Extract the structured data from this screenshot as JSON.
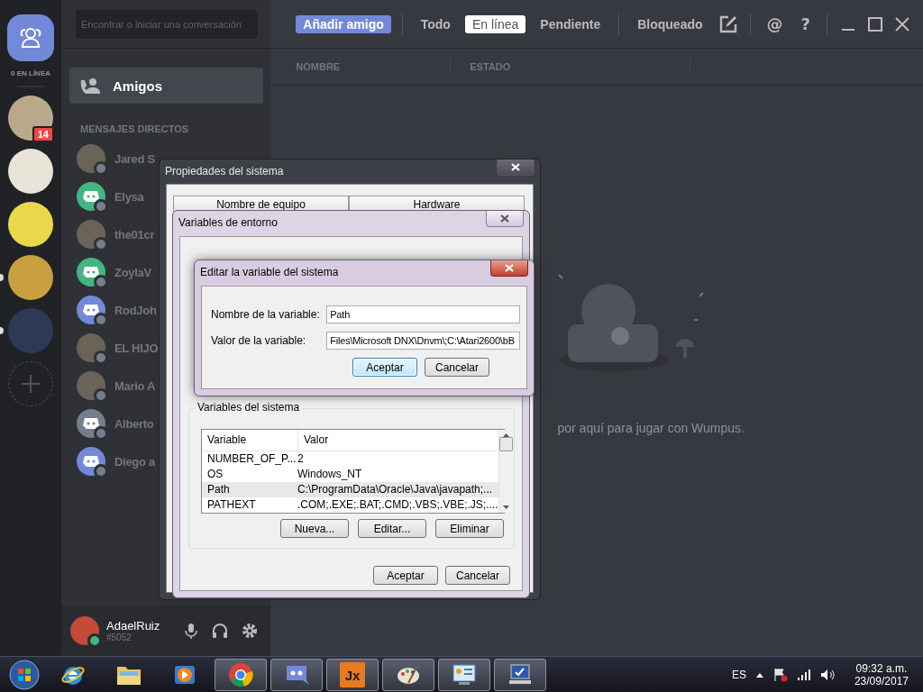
{
  "guild_rail": {
    "online_label": "0 EN LÍNEA",
    "servers": [
      {
        "badge": "14",
        "unread": false
      },
      {
        "unread": false
      },
      {
        "unread": false
      },
      {
        "unread": true
      },
      {
        "unread": true
      }
    ]
  },
  "search": {
    "placeholder": "Encontrar o iniciar una conversación"
  },
  "friends_item": {
    "label": "Amigos",
    "selected": true
  },
  "dm_section": "MENSAJES DIRECTOS",
  "dms": [
    {
      "name": "Jared S",
      "kind": "photo"
    },
    {
      "name": "Elysa",
      "kind": "default",
      "color": "#43b581"
    },
    {
      "name": "the01cr",
      "kind": "photo"
    },
    {
      "name": "ZoylaV",
      "kind": "default",
      "color": "#43b581"
    },
    {
      "name": "RodJoh",
      "kind": "default",
      "color": "#7289da"
    },
    {
      "name": "EL HIJO",
      "kind": "photo"
    },
    {
      "name": "Mario A",
      "kind": "photo"
    },
    {
      "name": "Alberto",
      "kind": "default",
      "color": "#747f8d"
    },
    {
      "name": "Diego a",
      "kind": "default",
      "color": "#7289da"
    }
  ],
  "user": {
    "name": "AdaelRuiz",
    "tag": "#5052"
  },
  "tabs": [
    {
      "label": "Añadir amigo",
      "kind": "button"
    },
    {
      "label": "Todo",
      "kind": "tab",
      "selected": false
    },
    {
      "label": "En línea",
      "kind": "tab",
      "selected": true
    },
    {
      "label": "Pendiente",
      "kind": "tab",
      "selected": false
    },
    {
      "label": "Bloqueado",
      "kind": "tab",
      "selected": false
    }
  ],
  "header_icons": [
    "@",
    "?"
  ],
  "columns": [
    "NOMBRE",
    "ESTADO"
  ],
  "empty_text": "por aquí para jugar con Wumpus.",
  "system_properties": {
    "title": "Propiedades del sistema",
    "tabs": [
      "Nombre de equipo",
      "Hardware"
    ]
  },
  "environment_variables": {
    "title": "Variables de entorno",
    "group_title": "Variables del sistema",
    "columns": [
      "Variable",
      "Valor"
    ],
    "rows": [
      {
        "variable": "NUMBER_OF_P...",
        "value": "2",
        "selected": false
      },
      {
        "variable": "OS",
        "value": "Windows_NT",
        "selected": false
      },
      {
        "variable": "Path",
        "value": "C:\\ProgramData\\Oracle\\Java\\javapath;...",
        "selected": true
      },
      {
        "variable": "PATHEXT",
        "value": ".COM;.EXE;.BAT;.CMD;.VBS;.VBE;.JS;....",
        "selected": false
      }
    ],
    "row_buttons": [
      "Nueva...",
      "Editar...",
      "Eliminar"
    ],
    "buttons": [
      "Aceptar",
      "Cancelar"
    ]
  },
  "edit_variable": {
    "title": "Editar la variable del sistema",
    "name_label": "Nombre de la variable:",
    "name_value": "Path",
    "value_label": "Valor de la variable:",
    "value": "Files\\Microsoft DNX\\Dnvm\\;C:\\Atari2600\\bB",
    "buttons": [
      {
        "label": "Aceptar",
        "default": true
      },
      {
        "label": "Cancelar",
        "default": false
      }
    ]
  },
  "taskbar": {
    "apps": [
      {
        "kind": "ie",
        "open": false
      },
      {
        "kind": "folder",
        "open": false
      },
      {
        "kind": "media",
        "open": false
      },
      {
        "kind": "chrome",
        "open": true
      },
      {
        "kind": "discord",
        "open": true
      },
      {
        "kind": "jx",
        "label": "Jx",
        "open": true
      },
      {
        "kind": "paint",
        "open": true
      },
      {
        "kind": "panel",
        "open": true
      },
      {
        "kind": "system",
        "open": true
      }
    ],
    "language": "ES",
    "time": "09:32 a.m.",
    "date": "23/09/2017"
  }
}
